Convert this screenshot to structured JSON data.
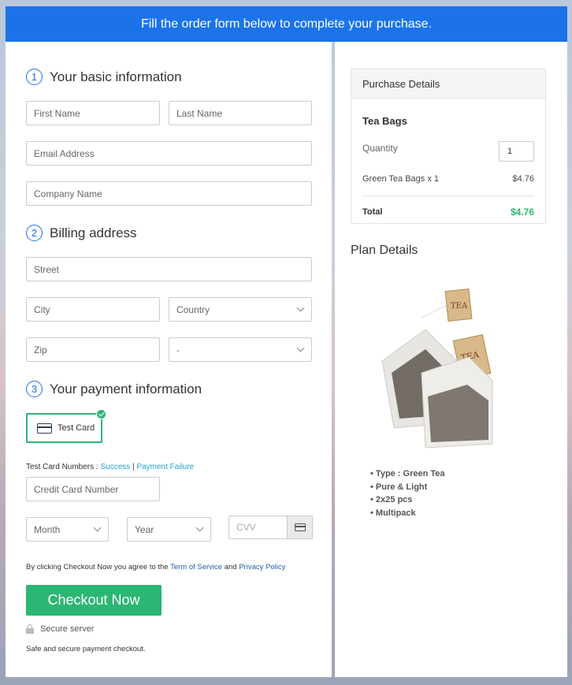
{
  "header": {
    "banner": "Fill the order form below to complete your purchase."
  },
  "basic_info": {
    "step": "1",
    "title": "Your basic information",
    "first_name_placeholder": "First Name",
    "last_name_placeholder": "Last Name",
    "email_placeholder": "Email Address",
    "company_placeholder": "Company Name"
  },
  "billing": {
    "step": "2",
    "title": "Billing address",
    "street_placeholder": "Street",
    "city_placeholder": "City",
    "country_placeholder": "Country",
    "zip_placeholder": "Zip",
    "state_value": "-"
  },
  "payment": {
    "step": "3",
    "title": "Your payment information",
    "test_card_label": "Test Card",
    "test_numbers_label": "Test Card Numbers : ",
    "success_link": "Success",
    "separator": " | ",
    "failure_link": "Payment Failure",
    "credit_card_placeholder": "Credit Card Number",
    "month_placeholder": "Month",
    "year_placeholder": "Year",
    "cvv_placeholder": "CVV"
  },
  "terms": {
    "prefix": "By clicking Checkout Now you agree to the ",
    "terms_link": "Term of Service",
    "and": " and ",
    "privacy_link": "Privacy Policy"
  },
  "checkout": {
    "button_label": "Checkout Now",
    "secure_label": "Secure server",
    "safe_text": "Safe and secure payment checkout."
  },
  "purchase": {
    "header": "Purchase Details",
    "product": "Tea Bags",
    "quantity_label": "Quantity",
    "quantity_value": "1",
    "line_item": "Green Tea Bags x 1",
    "line_price": "$4.76",
    "total_label": "Total",
    "total_value": "$4.76",
    "total_color": "#2bb673"
  },
  "plan": {
    "title": "Plan Details",
    "features": [
      "Type : Green Tea",
      "Pure & Light",
      "2x25 pcs",
      "Multipack"
    ]
  },
  "colors": {
    "accent": "#1c73e8",
    "success": "#2bb673"
  }
}
